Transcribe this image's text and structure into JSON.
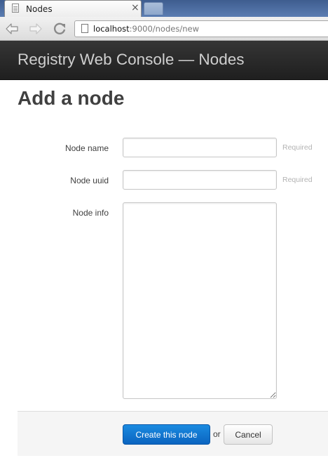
{
  "browser": {
    "tab_title": "Nodes",
    "tab_close": "×",
    "url_host": "localhost",
    "url_path": ":9000/nodes/new"
  },
  "app": {
    "title": "Registry Web Console — Nodes"
  },
  "page": {
    "heading": "Add a node"
  },
  "form": {
    "fields": [
      {
        "label": "Node name",
        "value": "",
        "help": "Required"
      },
      {
        "label": "Node uuid",
        "value": "",
        "help": "Required"
      },
      {
        "label": "Node info",
        "value": ""
      }
    ],
    "submit_label": "Create this node",
    "or_text": "or",
    "cancel_label": "Cancel"
  },
  "icons": {
    "tab": "document-icon",
    "back": "back-arrow-icon",
    "forward": "forward-arrow-icon",
    "reload": "reload-icon",
    "url": "page-icon"
  },
  "colors": {
    "header_bg": "#222222",
    "header_text": "#cfcfcf",
    "primary_button": "#0f74d3",
    "help_text": "#b3b3b3"
  }
}
